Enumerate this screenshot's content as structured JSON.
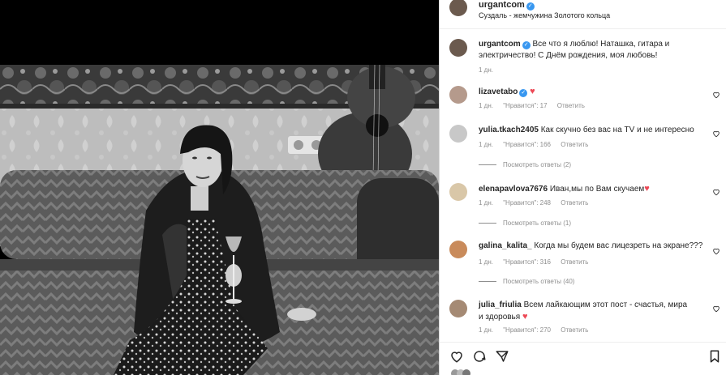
{
  "post": {
    "username": "urgantcom",
    "location": "Суздаль - жемчужина Золотого кольца"
  },
  "caption": {
    "username": "urgantcom",
    "text": "Все что я люблю! Наташка, гитара и электричество! С Днём рождения, моя любовь!",
    "time": "1 дн."
  },
  "comments": [
    {
      "username": "lizavetabo",
      "text": "",
      "time": "1 дн.",
      "likes": "\"Нравится\": 17",
      "reply": "Ответить",
      "verified": true,
      "heart": true
    },
    {
      "username": "yulia.tkach2405",
      "text": "Как скучно без вас на TV и не интересно",
      "time": "1 дн.",
      "likes": "\"Нравится\": 166",
      "reply": "Ответить",
      "view_replies": "Посмотреть ответы (2)"
    },
    {
      "username": "elenapavlova7676",
      "text": "Иван,мы по Вам скучаем",
      "time": "1 дн.",
      "likes": "\"Нравится\": 248",
      "reply": "Ответить",
      "view_replies": "Посмотреть ответы (1)",
      "heart": true
    },
    {
      "username": "galina_kalita_",
      "text": "Когда мы будем вас лицезреть на экране???",
      "time": "1 дн.",
      "likes": "\"Нравится\": 316",
      "reply": "Ответить",
      "view_replies": "Посмотреть ответы (40)"
    },
    {
      "username": "julia_friulia",
      "text": "Всем лайкающим этот пост - счастья, мира и здоровья",
      "time": "1 дн.",
      "likes": "\"Нравится\": 270",
      "reply": "Ответить",
      "heart": true
    }
  ],
  "icons": [
    "heart-icon",
    "comment-icon",
    "share-icon",
    "bookmark-icon",
    "verified-icon"
  ],
  "colors": {
    "verified": "#3897f0",
    "heart": "#ed4956",
    "meta": "#8e8e8e",
    "text": "#262626"
  }
}
